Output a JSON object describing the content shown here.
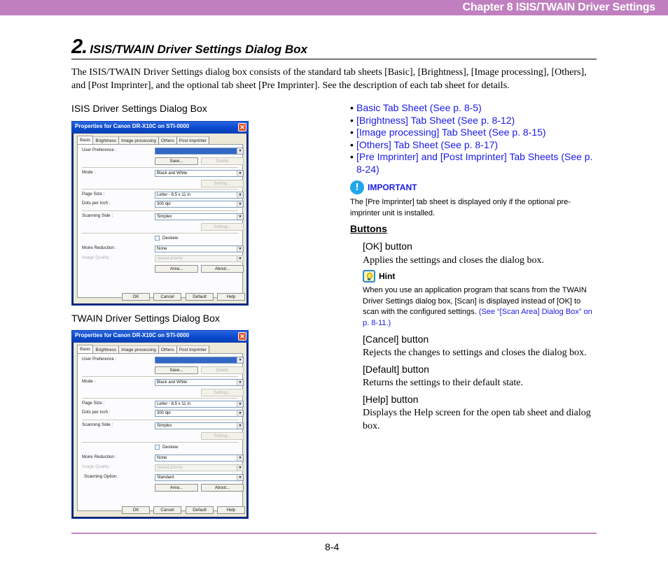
{
  "header": {
    "chapter": "Chapter 8   ISIS/TWAIN Driver Settings",
    "color": "#c07fbf"
  },
  "section": {
    "number": "2.",
    "title": "ISIS/TWAIN Driver Settings Dialog Box"
  },
  "intro": "The ISIS/TWAIN Driver Settings dialog box consists of the standard tab sheets [Basic], [Brightness], [Image processing], [Others], and [Post Imprinter], and the optional tab sheet [Pre Imprinter]. See the description of each tab sheet for details.",
  "figures": [
    {
      "caption": "ISIS Driver Settings Dialog Box",
      "dialog": {
        "title": "Properties for Canon DR-X10C on STI-0000",
        "tabs": [
          "Basic",
          "Brightness",
          "Image processing",
          "Others",
          "Post Imprinter"
        ],
        "labels": {
          "user_pref": "User Preference :",
          "mode": "Mode :",
          "page_size": "Page Size :",
          "dpi": "Dots per inch :",
          "side": "Scanning Side :",
          "moire": "Moire Reduction :",
          "quality": "Image Quality :"
        },
        "values": {
          "mode": "Black and White",
          "page_size": "Letter - 8.5 x 11 in",
          "dpi": "300 dpi",
          "side": "Simplex",
          "moire": "None",
          "quality": "Speed priority"
        },
        "buttons": {
          "save": "Save...",
          "delete": "Delete",
          "setting": "Setting...",
          "area": "Area...",
          "about": "About..."
        },
        "deskew": "Deskew",
        "footer": [
          "OK",
          "Cancel",
          "Default",
          "Help"
        ]
      }
    },
    {
      "caption": "TWAIN Driver Settings Dialog Box",
      "dialog": {
        "title": "Properties for Canon DR-X10C on STI-0000",
        "tabs": [
          "Basic",
          "Brightness",
          "Image processing",
          "Others",
          "Post Imprinter"
        ],
        "labels": {
          "user_pref": "User Preference :",
          "mode": "Mode :",
          "page_size": "Page Size :",
          "dpi": "Dots per inch :",
          "side": "Scanning Side :",
          "moire": "Moire Reduction :",
          "quality": "Image Quality :",
          "option": "Scanning Option :"
        },
        "values": {
          "mode": "Black and White",
          "page_size": "Letter - 8.5 x 11 in",
          "dpi": "300 dpi",
          "side": "Simplex",
          "moire": "None",
          "quality": "Speed priority",
          "option": "Standard"
        },
        "buttons": {
          "save": "Save...",
          "delete": "Delete",
          "setting": "Setting...",
          "area": "Area...",
          "about": "About..."
        },
        "deskew": "Deskew",
        "footer": [
          "OK",
          "Cancel",
          "Default",
          "Help"
        ]
      }
    }
  ],
  "links": [
    "Basic Tab Sheet (See p. 8-5)",
    "[Brightness] Tab Sheet (See p. 8-12)",
    "[Image processing] Tab Sheet (See p. 8-15)",
    "[Others] Tab Sheet (See p. 8-17)",
    "[Pre Imprinter] and [Post Imprinter] Tab Sheets (See p. 8-24)"
  ],
  "bullet": "•",
  "important": {
    "icon": "!",
    "label": "IMPORTANT",
    "text": "The [Pre Imprinter] tab sheet is displayed only if the optional pre-imprinter unit is installed."
  },
  "buttons_section": {
    "heading": "Buttons",
    "items": [
      {
        "title": "[OK] button",
        "desc": "Applies the settings and closes the dialog box."
      },
      {
        "title": "[Cancel] button",
        "desc": "Rejects the changes to settings and closes the dialog box."
      },
      {
        "title": "[Default] button",
        "desc": "Returns the settings to their default state."
      },
      {
        "title": "[Help] button",
        "desc": "Displays the Help screen for the open tab sheet and dialog box."
      }
    ],
    "hint": {
      "label": "Hint",
      "text": "When you use an application program that scans from the TWAIN Driver Settings dialog box, [Scan] is displayed instead of [OK] to scan with the configured settings. ",
      "link": "(See “[Scan Area] Dialog Box” on p. 8-11.)"
    }
  },
  "page_number": "8-4"
}
